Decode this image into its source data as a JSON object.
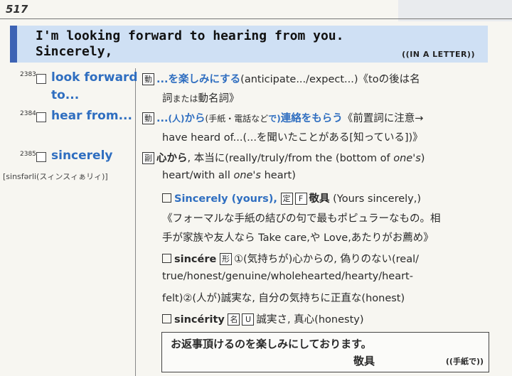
{
  "page_number": "517",
  "header": {
    "line1": "I'm looking forward to hearing from you.",
    "line2": "Sincerely,",
    "tag": "((IN A LETTER))"
  },
  "entries": [
    {
      "number": "2383",
      "headword_l1": "look forward",
      "headword_l2": "to...",
      "pos_icon": "動",
      "def_main": "...を楽しみにする",
      "def_l1_rest": "(anticipate.../expect...)《toの後は名",
      "def_l2_a": "詞",
      "def_l2_small": "または",
      "def_l2_b": "動名詞》"
    },
    {
      "number": "2384",
      "headword": "hear from...",
      "pos_icon": "動",
      "def_pre": "...",
      "def_person": "(人)",
      "def_from": "から",
      "def_means": "(手紙・電話など",
      "def_means_end": "で)",
      "def_main": "連絡をもらう",
      "def_l1_rest": "《前置詞に注意→",
      "def_l2": "have heard of...(...を聞いたことがある[知っている])》"
    },
    {
      "number": "2385",
      "headword": "sincerely",
      "pronunciation": "[sinsfərli(スィンスィぁリィ)]",
      "pos_icon": "副",
      "def_main": "心から",
      "def_l1_rest": ", 本当に(really/truly/from the (bottom of ",
      "def_l1_ital": "one's",
      "def_l1_end": ")",
      "def_l2_a": "heart/with all ",
      "def_l2_ital": "one's",
      "def_l2_b": " heart)",
      "sub1": {
        "phrase": "Sincerely (yours),",
        "icon1": "定",
        "icon2": "F",
        "meaning": "敬具",
        "gloss": "(Yours sincerely,)",
        "note_l1": "《フォーマルな手紙の結びの句で最もポピュラーなもの。相",
        "note_l2": "手が家族や友人なら Take care,や Love,あたりがお薦め》"
      },
      "sub2": {
        "word": "sincére",
        "icon": "形",
        "l1_rest": "①(気持ちが)心からの, 偽りのない(real/",
        "l2": "true/honest/genuine/wholehearted/hearty/heart-",
        "l3": "felt)②(人が)誠実な, 自分の気持ちに正直な(honest)"
      },
      "sub3": {
        "word": "sincérity",
        "icon1": "名",
        "icon2": "U",
        "l1_rest": "誠実さ, 真心(honesty)"
      }
    }
  ],
  "example": {
    "line1": "お返事頂けるのを楽しみにしております。",
    "line2": "敬具",
    "tag": "((手紙で))"
  }
}
